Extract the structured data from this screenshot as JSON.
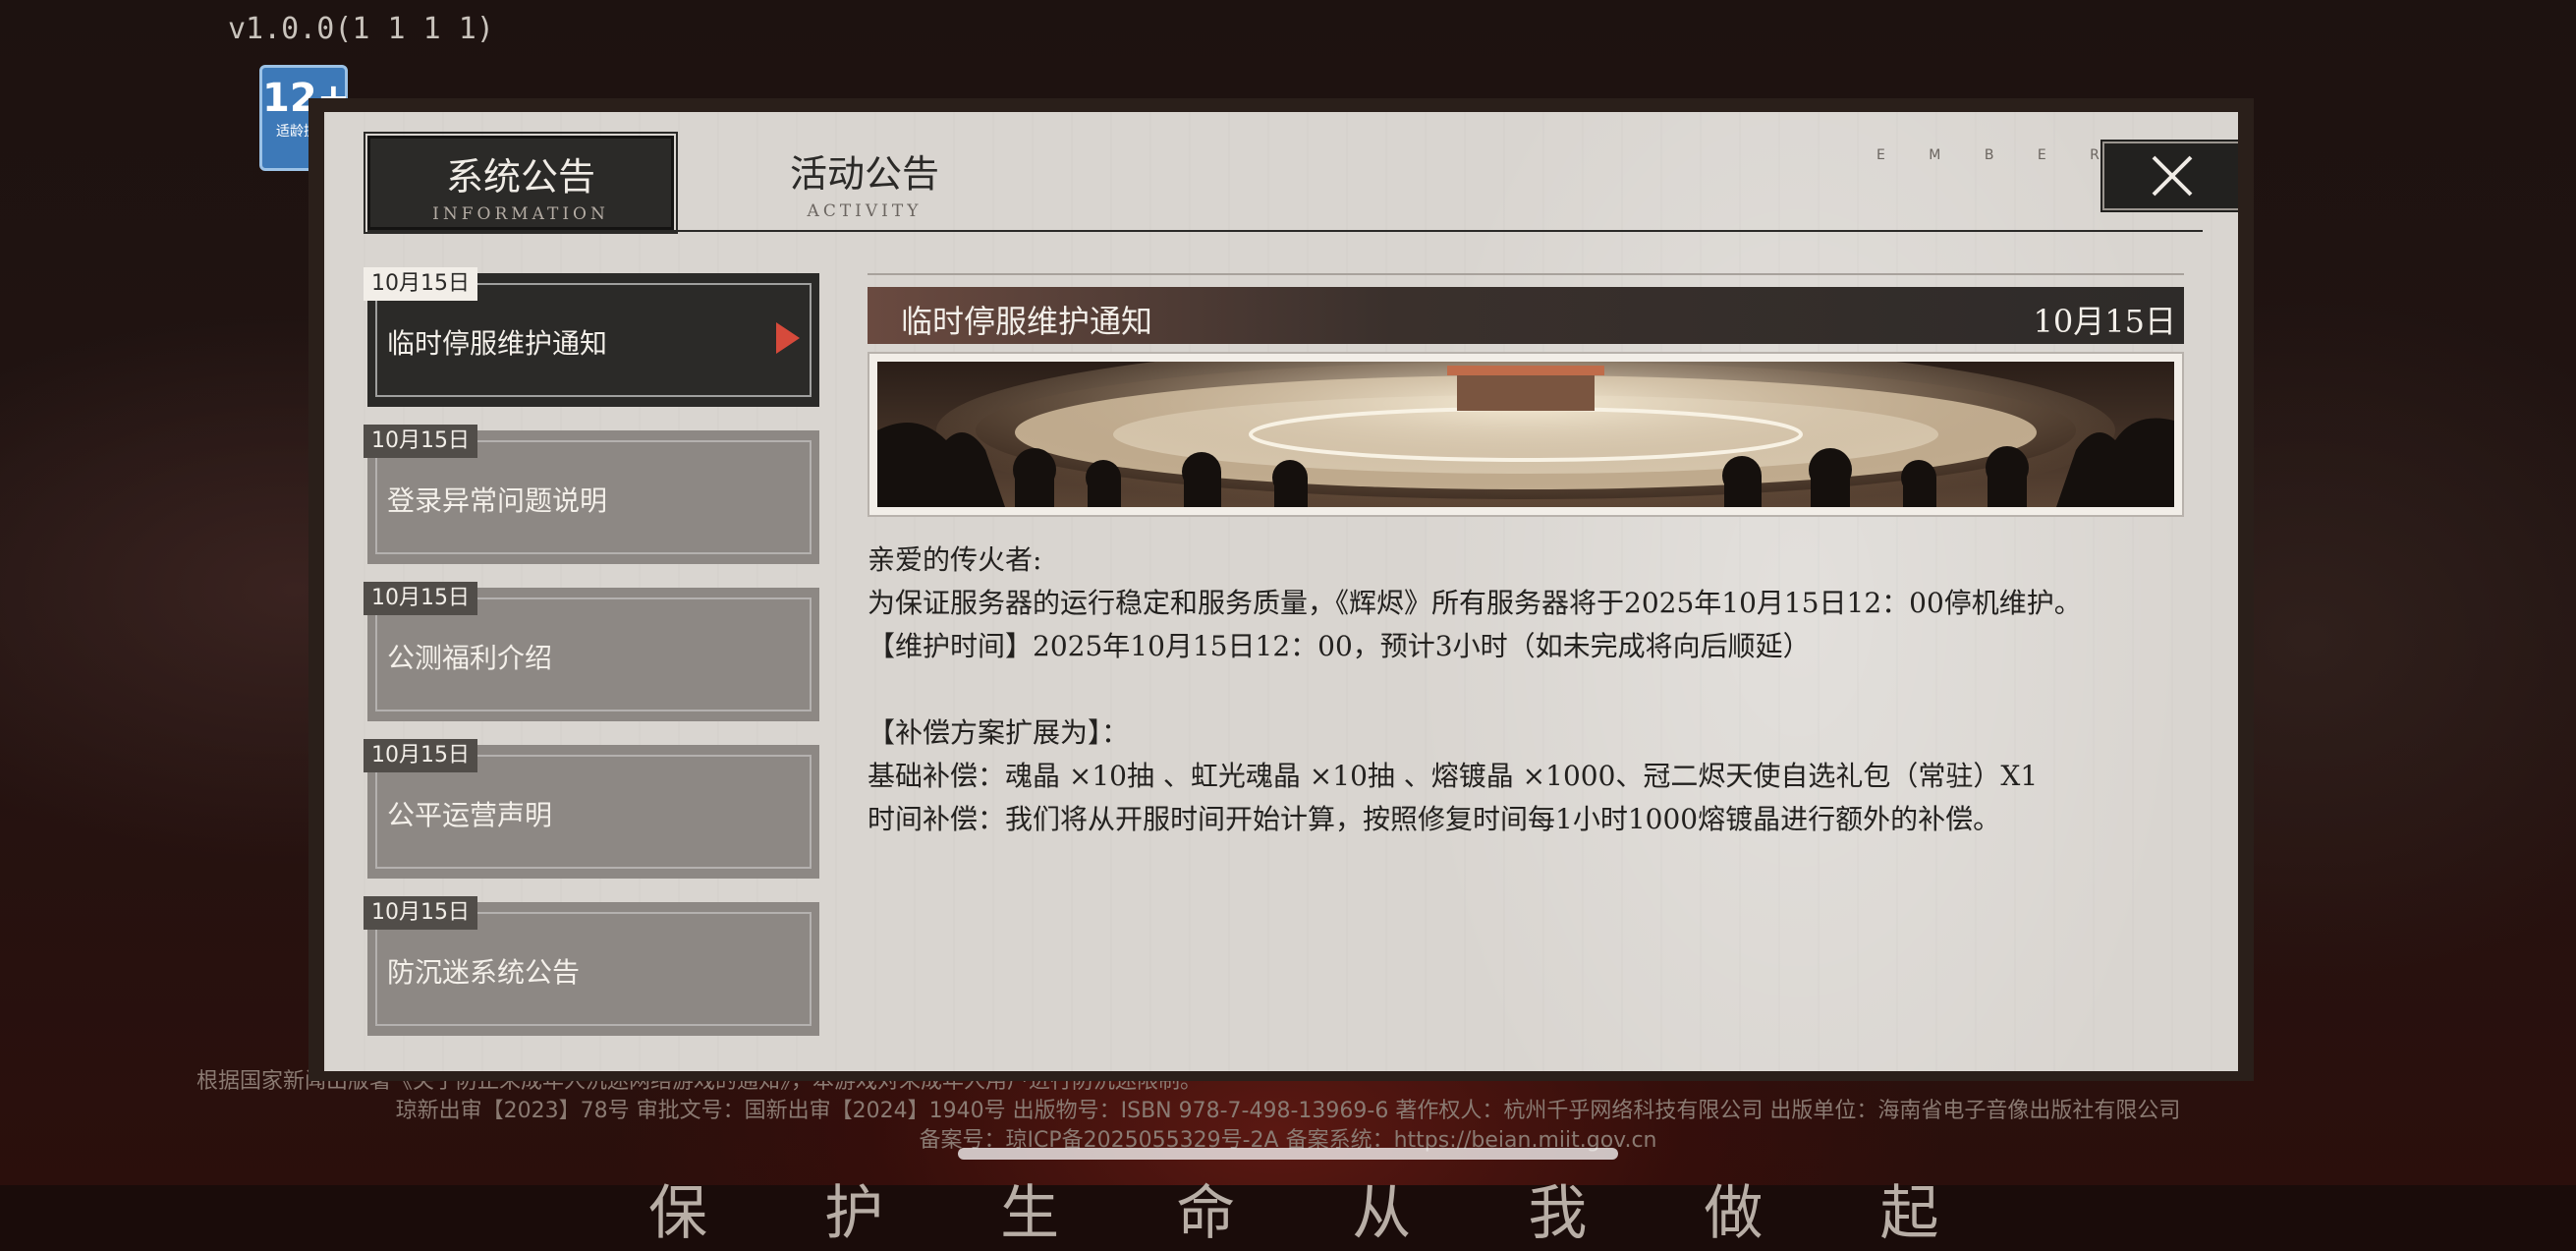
{
  "app": {
    "version": "v1.0.0(1 1 1 1)",
    "age_rating": {
      "number": "12+",
      "sub": "适龄提示"
    }
  },
  "tabs": [
    {
      "label": "系统公告",
      "sub": "INFORMATION",
      "active": true
    },
    {
      "label": "活动公告",
      "sub": "ACTIVITY",
      "active": false
    }
  ],
  "brand_tag": "E M B E R S",
  "close_icon": "close-x-icon",
  "announcements": [
    {
      "date": "10月15日",
      "title": "临时停服维护通知",
      "active": true
    },
    {
      "date": "10月15日",
      "title": "登录异常问题说明",
      "active": false
    },
    {
      "date": "10月15日",
      "title": "公测福利介绍",
      "active": false
    },
    {
      "date": "10月15日",
      "title": "公平运营声明",
      "active": false
    },
    {
      "date": "10月15日",
      "title": "防沉迷系统公告",
      "active": false
    }
  ],
  "detail": {
    "title": "临时停服维护通知",
    "date": "10月15日",
    "banner_alt": "casino-table-banner",
    "lines": [
      "亲爱的传火者:",
      "为保证服务器的运行稳定和服务质量，《辉烬》所有服务器将于2025年10月15日12：00停机维护。",
      "【维护时间】2025年10月15日12：00，预计3小时（如未完成将向后顺延）",
      "",
      "【补偿方案扩展为】：",
      "基础补偿：魂晶 ×10抽 、虹光魂晶 ×10抽 、熔镀晶 ×1000、冠二烬天使自选礼包（常驻）X1",
      "时间补偿：我们将从开服时间开始计算，按照修复时间每1小时1000熔镀晶进行额外的补偿。"
    ]
  },
  "footer": {
    "line1": "根据国家新闻出版署《关于防止未成年人沉迷网络游戏的通知》，本游戏对未成年人用户进行防沉迷限制。",
    "line2": "琼新出审【2023】78号 审批文号：国新出审【2024】1940号 出版物号：ISBN 978-7-498-13969-6   著作权人：杭州千乎网络科技有限公司 出版单位：海南省电子音像出版社有限公司",
    "line3": "备案号：琼ICP备2025055329号-2A   备案系统：https://beian.miit.gov.cn"
  },
  "bottom_text": "保 护 生 命 从 我 做 起"
}
